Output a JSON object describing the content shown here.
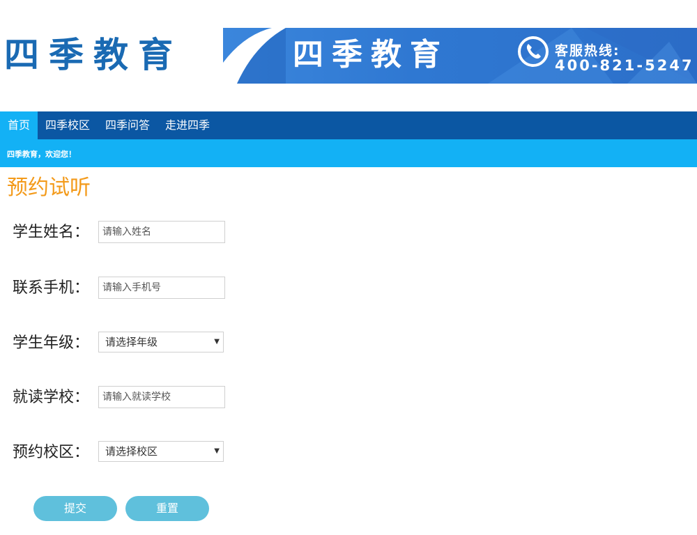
{
  "header": {
    "logo_text": "四季教育",
    "banner_title": "四季教育",
    "hotline_label": "客服热线:",
    "hotline_number": "400-821-5247"
  },
  "nav": {
    "items": [
      {
        "label": "首页",
        "active": true
      },
      {
        "label": "四季校区",
        "active": false
      },
      {
        "label": "四季问答",
        "active": false
      },
      {
        "label": "走进四季",
        "active": false
      }
    ]
  },
  "welcome": "四季教育，欢迎您！",
  "form": {
    "title": "预约试听",
    "student_name": {
      "label": "学生姓名：",
      "placeholder": "请输入姓名",
      "value": ""
    },
    "phone": {
      "label": "联系手机：",
      "placeholder": "请输入手机号",
      "value": ""
    },
    "grade": {
      "label": "学生年级：",
      "selected": "请选择年级"
    },
    "school": {
      "label": "就读学校：",
      "placeholder": "请输入就读学校",
      "value": ""
    },
    "campus": {
      "label": "预约校区：",
      "selected": "请选择校区"
    },
    "submit_label": "提交",
    "reset_label": "重置"
  },
  "colors": {
    "nav_bg": "#0b57a3",
    "accent_blue": "#13b1f5",
    "title_orange": "#f39a1a",
    "button": "#5fc0dc",
    "logo_blue": "#1a6ab3"
  }
}
